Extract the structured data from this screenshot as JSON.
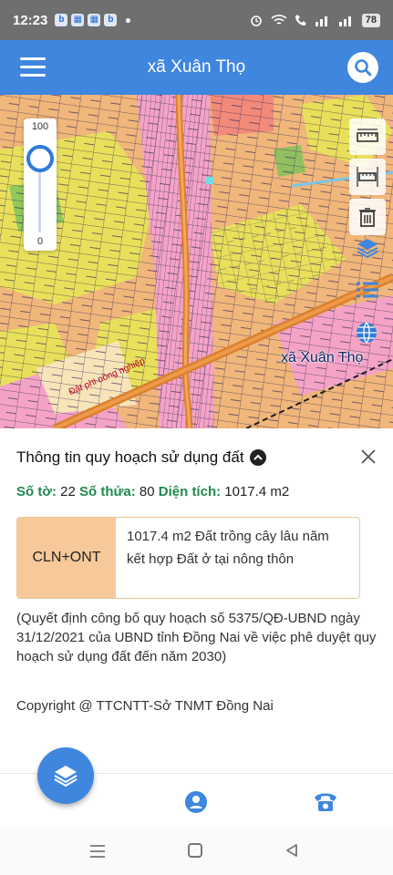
{
  "status_bar": {
    "time": "12:23",
    "battery": "78",
    "notification_icons": [
      "b",
      "▦",
      "▦",
      "b"
    ]
  },
  "app_bar": {
    "title": "xã Xuân Thọ",
    "menu_icon": "hamburger-menu-icon",
    "search_icon": "search-icon"
  },
  "map": {
    "zoom_max": "100",
    "zoom_min": "0",
    "zoom_level": 0.85,
    "place_label": "xã Xuân Thọ",
    "road_label": "Đất phi nông nghiệp",
    "tools": [
      "ruler-horizontal-icon",
      "ruler-area-icon",
      "trash-icon",
      "layers-icon",
      "legend-list-icon",
      "globe-icon"
    ],
    "colors": {
      "residential": "#f0b67a",
      "agricultural": "#e8e05a",
      "special": "#f4a3c6",
      "road": "#d9812c",
      "river": "#7bc6e8"
    }
  },
  "info_panel": {
    "title": "Thông tin quy hoạch sử dụng đất",
    "parcel": {
      "sheet_label": "Số tờ:",
      "sheet_value": "22",
      "parcel_label": "Số thửa:",
      "parcel_value": "80",
      "area_label": "Diện tích:",
      "area_value": "1017.4 m2"
    },
    "land_use": {
      "code": "CLN+ONT",
      "description": "1017.4 m2 Đất trồng cây lâu năm kết hợp Đất ở tại nông thôn"
    },
    "decision": "(Quyết định công bố quy hoạch số 5375/QĐ-UBND ngày 31/12/2021 của UBND tỉnh Đồng Nai về việc phê duyệt quy hoạch sử dụng đất đến năm 2030)",
    "copyright": "Copyright @ TTCNTT-Sở TNMT Đồng Nai"
  },
  "bottom_bar": {
    "fab_icon": "layers-icon",
    "user_icon": "user-icon",
    "phone_icon": "phone-icon"
  },
  "accent_color": "#3f86df"
}
